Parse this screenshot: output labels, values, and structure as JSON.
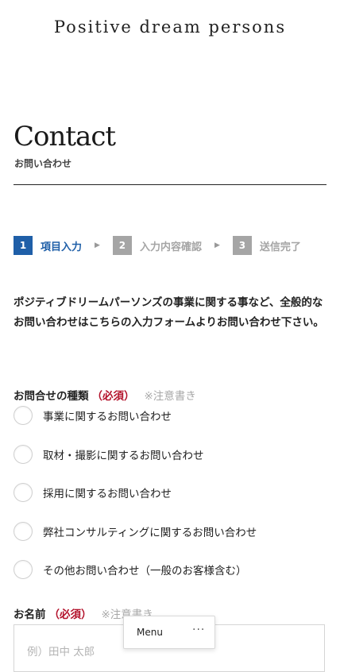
{
  "header": {
    "logo_text": "Positive dream persons"
  },
  "page": {
    "title": "Contact",
    "subtitle": "お問い合わせ"
  },
  "steps": [
    {
      "num": "1",
      "label": "項目入力",
      "active": true
    },
    {
      "num": "2",
      "label": "入力内容確認",
      "active": false
    },
    {
      "num": "3",
      "label": "送信完了",
      "active": false
    }
  ],
  "colors": {
    "accent": "#1f5fa8",
    "inactive_step": "#a5a5a5",
    "required": "#b3122b"
  },
  "intro_text": "ポジティブドリームパーソンズの事業に関する事など、全般的なお問い合わせはこちらの入力フォームよりお問い合わせ下さい。",
  "inquiry_type": {
    "label": "お問合せの種類",
    "required": "（必須）",
    "note": "※注意書き",
    "options": [
      "事業に関するお問い合わせ",
      "取材・撮影に関するお問い合わせ",
      "採用に関するお問い合わせ",
      "弊社コンサルティングに関するお問い合わせ",
      "その他お問い合わせ（一般のお客様含む）"
    ]
  },
  "name_field": {
    "label": "お名前",
    "required": "（必須）",
    "note": "※注意書き",
    "placeholder": "例）田中 太郎"
  },
  "menu": {
    "label": "Menu",
    "more": "···"
  }
}
